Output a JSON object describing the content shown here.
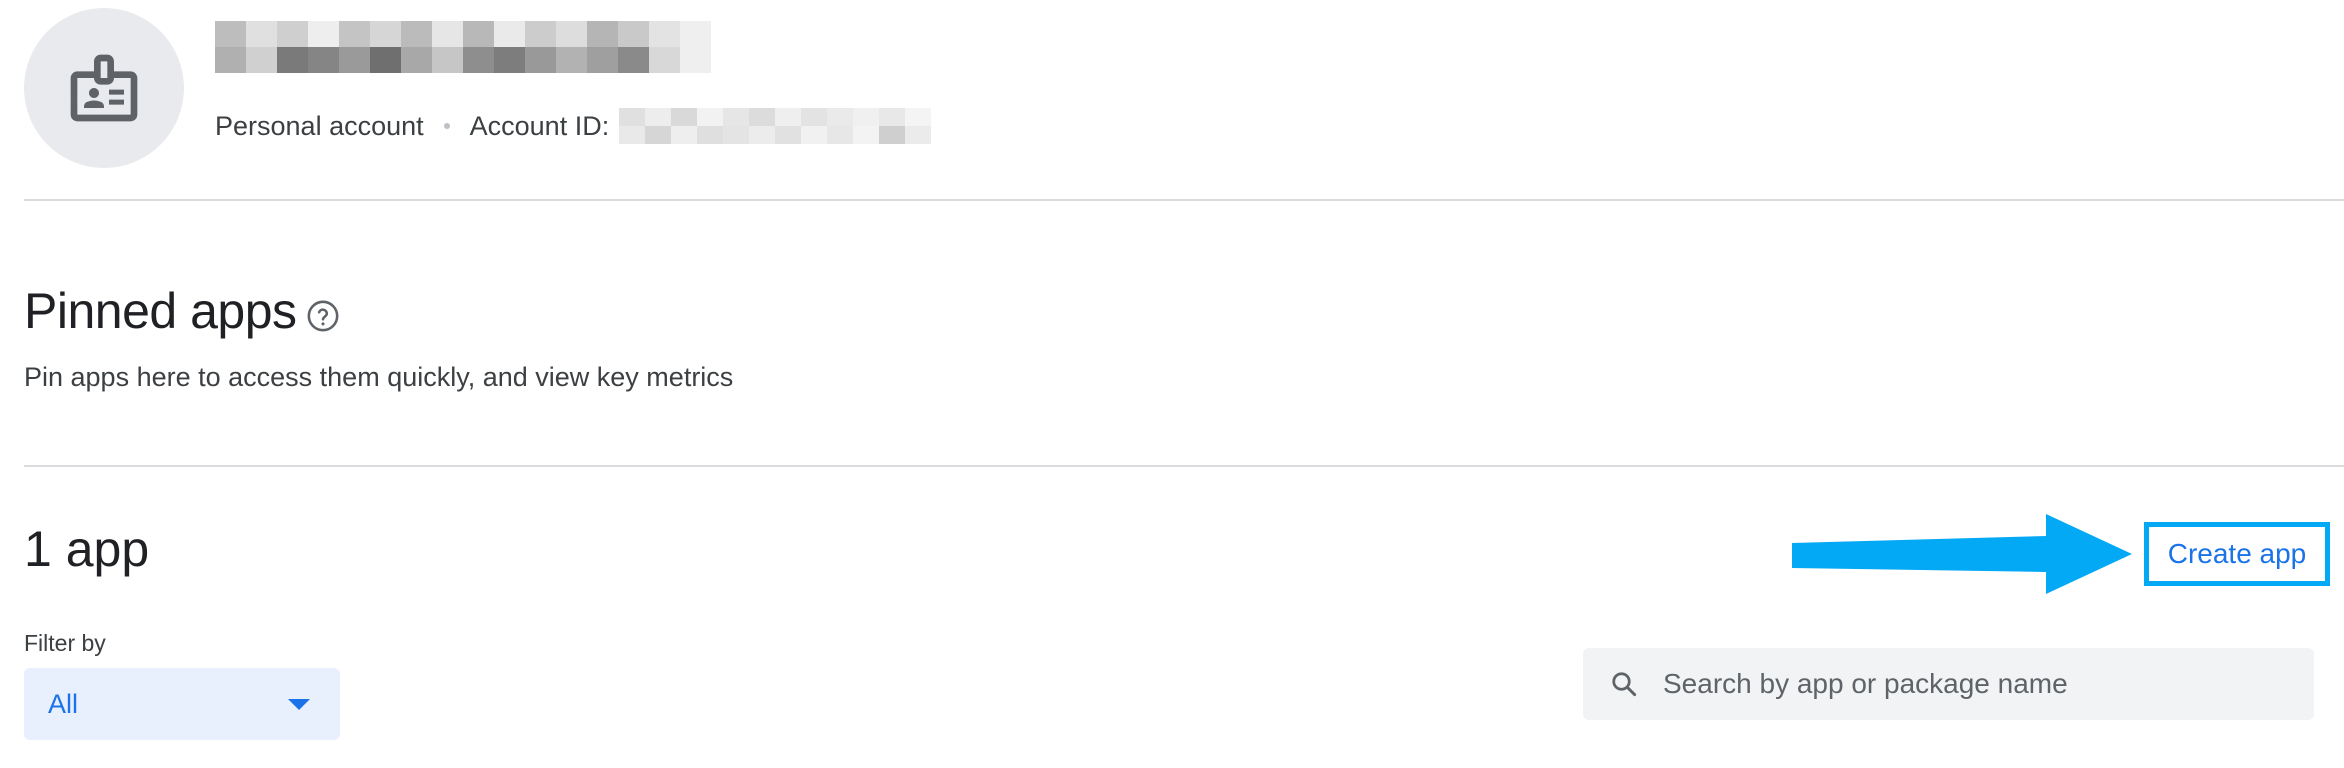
{
  "account": {
    "avatar_icon": "badge-icon",
    "type_label": "Personal account",
    "id_label": "Account ID:"
  },
  "pinned": {
    "title": "Pinned apps",
    "help_icon": "help-circle-icon",
    "description": "Pin apps here to access them quickly, and view key metrics"
  },
  "apps": {
    "count_label": "1 app",
    "create_button": "Create app",
    "annotation_icon": "arrow-right-icon",
    "annotation_color": "#03a9f4",
    "filter": {
      "label": "Filter by",
      "selected": "All"
    },
    "search": {
      "icon": "search-icon",
      "placeholder": "Search by app or package name"
    }
  },
  "colors": {
    "accent": "#1a73e8",
    "filter_bg": "#e8f0fe",
    "search_bg": "#f1f3f4",
    "divider": "#dadce0"
  }
}
